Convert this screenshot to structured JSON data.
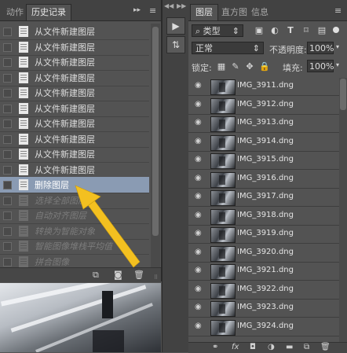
{
  "history_panel": {
    "tabs": [
      {
        "label": "动作",
        "active": false
      },
      {
        "label": "历史记录",
        "active": true
      }
    ],
    "menu_glyph": "▸▸",
    "items": [
      {
        "label": "从文件新建图层",
        "state": "normal"
      },
      {
        "label": "从文件新建图层",
        "state": "normal"
      },
      {
        "label": "从文件新建图层",
        "state": "normal"
      },
      {
        "label": "从文件新建图层",
        "state": "normal"
      },
      {
        "label": "从文件新建图层",
        "state": "normal"
      },
      {
        "label": "从文件新建图层",
        "state": "normal"
      },
      {
        "label": "从文件新建图层",
        "state": "normal"
      },
      {
        "label": "从文件新建图层",
        "state": "normal"
      },
      {
        "label": "从文件新建图层",
        "state": "normal"
      },
      {
        "label": "从文件新建图层",
        "state": "normal"
      },
      {
        "label": "删除图层",
        "state": "selected"
      },
      {
        "label": "选择全部图层",
        "state": "dim"
      },
      {
        "label": "自动对齐图层",
        "state": "dim"
      },
      {
        "label": "转换为智能对象",
        "state": "dim"
      },
      {
        "label": "智能图像堆栈平均值",
        "state": "dim"
      },
      {
        "label": "拼合图像",
        "state": "dim"
      }
    ],
    "bottom_icons": [
      "new-document-from-state-icon",
      "snapshot-camera-icon",
      "trash-icon"
    ]
  },
  "collapse_arrows": {
    "left": "◀◀",
    "right": "▶▶"
  },
  "layers_panel": {
    "tabs": [
      {
        "label": "图层",
        "active": true
      },
      {
        "label": "直方图",
        "active": false
      },
      {
        "label": "信息",
        "active": false
      }
    ],
    "filter_label": "类型",
    "blend_mode": "正常",
    "opacity_label": "不透明度:",
    "opacity_value": "100%",
    "lock_label": "锁定:",
    "fill_label": "填充:",
    "fill_value": "100%",
    "layers": [
      {
        "name": "IMG_3911.dng"
      },
      {
        "name": "IMG_3912.dng"
      },
      {
        "name": "IMG_3913.dng"
      },
      {
        "name": "IMG_3914.dng"
      },
      {
        "name": "IMG_3915.dng"
      },
      {
        "name": "IMG_3916.dng"
      },
      {
        "name": "IMG_3917.dng"
      },
      {
        "name": "IMG_3918.dng"
      },
      {
        "name": "IMG_3919.dng"
      },
      {
        "name": "IMG_3920.dng"
      },
      {
        "name": "IMG_3921.dng"
      },
      {
        "name": "IMG_3922.dng"
      },
      {
        "name": "IMG_3923.dng"
      },
      {
        "name": "IMG_3924.dng"
      }
    ],
    "bottom_icons": [
      "link-icon",
      "fx-icon",
      "mask-icon",
      "adjustment-icon",
      "group-folder-icon",
      "new-layer-icon",
      "trash-icon"
    ]
  },
  "colors": {
    "panel_bg": "#535353",
    "selected_row": "#8a9bb3",
    "annotation_arrow": "#f3c020"
  }
}
